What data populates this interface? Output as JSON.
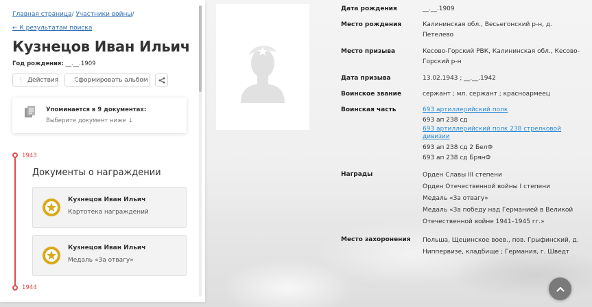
{
  "breadcrumb": {
    "home": "Главная страница",
    "sep1": "/ ",
    "participants": "Участники войны",
    "sep2": "/"
  },
  "back_link": "← К результатам поиска",
  "person": {
    "name": "Кузнецов Иван Ильич",
    "birth_label": "Год рождения:",
    "birth_value": "__.__.1909"
  },
  "buttons": {
    "actions": "Действия",
    "album": "Сформировать альбом"
  },
  "docs_card": {
    "title": "Упоминается в 9 документах:",
    "subtitle": "Выберите документ ниже ↓"
  },
  "timeline": {
    "years": [
      "1943",
      "1944"
    ],
    "section_title": "Документы о награждении",
    "awards": [
      {
        "name": "Кузнецов Иван Ильич",
        "type": "Картотека награждений"
      },
      {
        "name": "Кузнецов Иван Ильич",
        "type": "Медаль «За отвагу»"
      }
    ]
  },
  "details": [
    {
      "label": "Дата рождения",
      "lines": [
        "__.__.1909"
      ]
    },
    {
      "label": "Место рождения",
      "lines": [
        "Калининская обл., Весьегонский р-н, д.",
        "Петелево"
      ]
    },
    {
      "label": "Место призыва",
      "lines": [
        "Кесово-Горский РВК, Калининская обл., Кесово-",
        "Горский р-н"
      ]
    },
    {
      "label": "Дата призыва",
      "lines": [
        "13.02.1943 ; __.__.1942"
      ]
    },
    {
      "label": "Воинское звание",
      "lines": [
        "сержант ; мл. сержант ; красноармеец"
      ]
    },
    {
      "label": "Воинская часть",
      "lines": [
        "693 артиллерийский полк",
        "693 ап 238 сд",
        "693 артиллерийский полк 238 стрелковой",
        "дивизии",
        "693 ап 238 сд 2 БелФ",
        "693 ап 238 сд БрянФ"
      ]
    },
    {
      "label": "Награды",
      "lines": [
        "Орден Славы III степени",
        "Орден Отечественной войны I степени",
        "Медаль «За отвагу»",
        "Медаль «За победу над Германией в Великой",
        "Отечественной войне 1941–1945 гг.»"
      ]
    },
    {
      "label": "Место захоронения",
      "lines": [
        "Польша, Щецинское воев., пов. Грыфинский, д.",
        "Ниппервизе, кладбище ; Германия, г. Шведт"
      ]
    }
  ],
  "colors": {
    "accent_red": "#e04b4b",
    "link_blue": "#2b6cb0",
    "unit_link_blue": "#2b8ad6",
    "medal_gold": "#d9a919"
  },
  "icons": {
    "actions": "vertical-dots-icon",
    "album": "pdf-icon",
    "share": "share-icon",
    "docs": "documents-icon",
    "medal": "medal-star-icon",
    "photo": "soldier-silhouette-icon",
    "scroll_top": "chevron-up-icon"
  }
}
